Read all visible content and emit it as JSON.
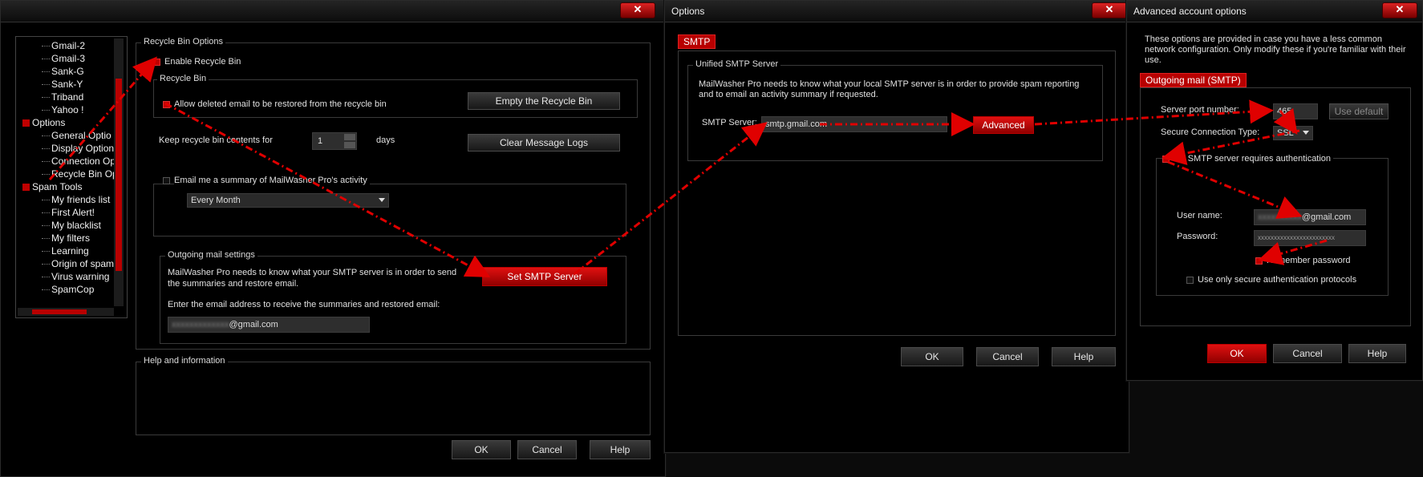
{
  "window1": {
    "tree_items": [
      "Gmail-2",
      "Gmail-3",
      "Sank-G",
      "Sank-Y",
      "Triband",
      "Yahoo !",
      "Options",
      "General Optio",
      "Display Option",
      "Connection Op",
      "Recycle Bin Op",
      "Spam Tools",
      "My friends list",
      "First Alert!",
      "My blacklist",
      "My filters",
      "Learning",
      "Origin of spam",
      "Virus warning",
      "SpamCop"
    ],
    "recycle_group_label": "Recycle Bin Options",
    "enable_recycle_label": "Enable Recycle Bin",
    "recycle_bin_label": "Recycle Bin",
    "allow_restore_label": "Allow deleted email to be restored from the recycle bin",
    "empty_recycle_button": "Empty the Recycle Bin",
    "keep_contents_label": "Keep recycle bin contents for",
    "keep_days_value": "1",
    "days_label": "days",
    "clear_logs_button": "Clear Message Logs",
    "email_summary_label": "Email me a summary of MailWasher Pro's activity",
    "frequency_value": "Every Month",
    "outgoing_label": "Outgoing mail settings",
    "outgoing_desc1": "MailWasher Pro needs to know what your SMTP server is in order to send",
    "outgoing_desc2": "the summaries and restore email.",
    "set_smtp_button": "Set SMTP Server",
    "enter_email_label": "Enter the email address to receive the summaries and restored email:",
    "email_blurred": "xxxxxxxxxxxxx",
    "email_domain": "@gmail.com",
    "help_label": "Help and information",
    "ok": "OK",
    "cancel": "Cancel",
    "help": "Help"
  },
  "window2": {
    "title": "Options",
    "tab": "SMTP",
    "group_label": "Unified SMTP Server",
    "desc1": "MailWasher Pro needs to know what your local SMTP server is in order to provide spam reporting",
    "desc2": "and to email an activity summary if requested.",
    "smtp_server_label": "SMTP Server:",
    "smtp_server_value": "smtp.gmail.com",
    "advanced_button": "Advanced",
    "ok": "OK",
    "cancel": "Cancel",
    "help": "Help"
  },
  "window3": {
    "title": "Advanced account options",
    "desc1": "These options are provided in case you have a less common",
    "desc2": "network configuration. Only modify these if you're familiar with their",
    "desc3": "use.",
    "tab": "Outgoing mail (SMTP)",
    "port_label": "Server port number:",
    "port_value": "465",
    "use_default_button": "Use default",
    "secure_type_label": "Secure Connection Type:",
    "secure_type_value": "SSL",
    "auth_label": "My SMTP server requires authentication",
    "username_label": "User name:",
    "username_blurred": "xxxxxxxxxx",
    "username_domain": "@gmail.com",
    "password_label": "Password:",
    "password_value": "xxxxxxxxxxxxxxxxxxxxxxxx",
    "remember_label": "Remember password",
    "secure_only_label": "Use only secure authentication protocols",
    "ok": "OK",
    "cancel": "Cancel",
    "help": "Help"
  },
  "colors": {
    "accent": "#c00000",
    "arrow": "#e00000",
    "background": "#000000"
  }
}
